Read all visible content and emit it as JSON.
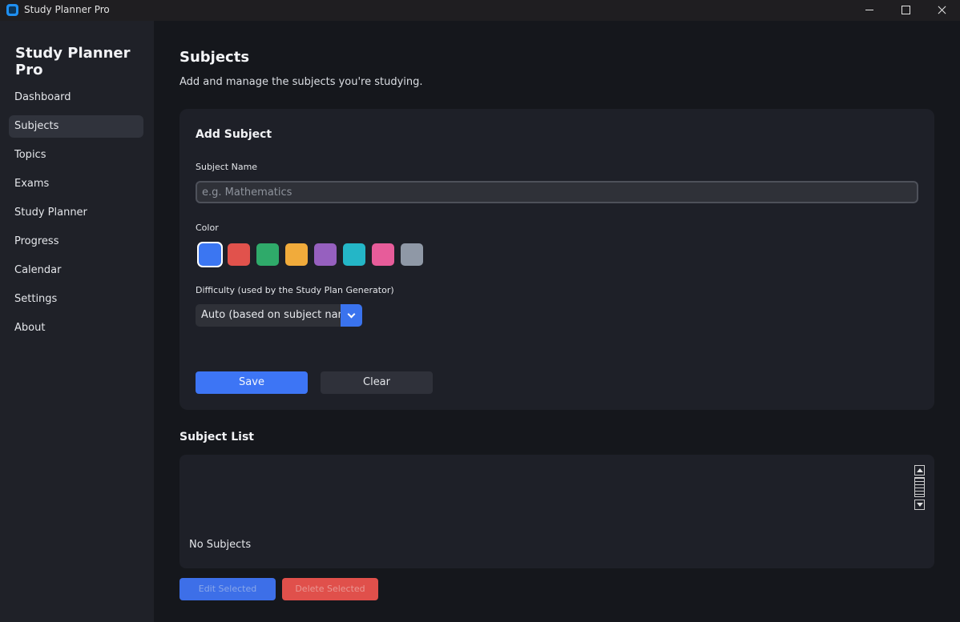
{
  "window": {
    "title": "Study Planner Pro"
  },
  "sidebar": {
    "brand": "Study Planner Pro",
    "items": [
      {
        "label": "Dashboard",
        "active": false
      },
      {
        "label": "Subjects",
        "active": true
      },
      {
        "label": "Topics",
        "active": false
      },
      {
        "label": "Exams",
        "active": false
      },
      {
        "label": "Study Planner",
        "active": false
      },
      {
        "label": "Progress",
        "active": false
      },
      {
        "label": "Calendar",
        "active": false
      },
      {
        "label": "Settings",
        "active": false
      },
      {
        "label": "About",
        "active": false
      }
    ]
  },
  "main": {
    "title": "Subjects",
    "subtitle": "Add and manage the subjects you're studying."
  },
  "form": {
    "title": "Add Subject",
    "name_label": "Subject Name",
    "name_placeholder": "e.g. Mathematics",
    "name_value": "",
    "color_label": "Color",
    "colors": [
      {
        "name": "blue",
        "hex": "#3b76f2",
        "selected": true
      },
      {
        "name": "red",
        "hex": "#e1524c",
        "selected": false
      },
      {
        "name": "green",
        "hex": "#2faa6a",
        "selected": false
      },
      {
        "name": "orange",
        "hex": "#f1ab3b",
        "selected": false
      },
      {
        "name": "purple",
        "hex": "#9660bf",
        "selected": false
      },
      {
        "name": "teal",
        "hex": "#24b6c7",
        "selected": false
      },
      {
        "name": "pink",
        "hex": "#e75c9a",
        "selected": false
      },
      {
        "name": "gray",
        "hex": "#8f98a6",
        "selected": false
      }
    ],
    "difficulty_label": "Difficulty (used by the Study Plan Generator)",
    "difficulty_value": "Auto (based on subject name)",
    "save_label": "Save",
    "clear_label": "Clear"
  },
  "subject_list": {
    "title": "Subject List",
    "empty_text": "No Subjects",
    "edit_label": "Edit Selected",
    "delete_label": "Delete Selected"
  }
}
